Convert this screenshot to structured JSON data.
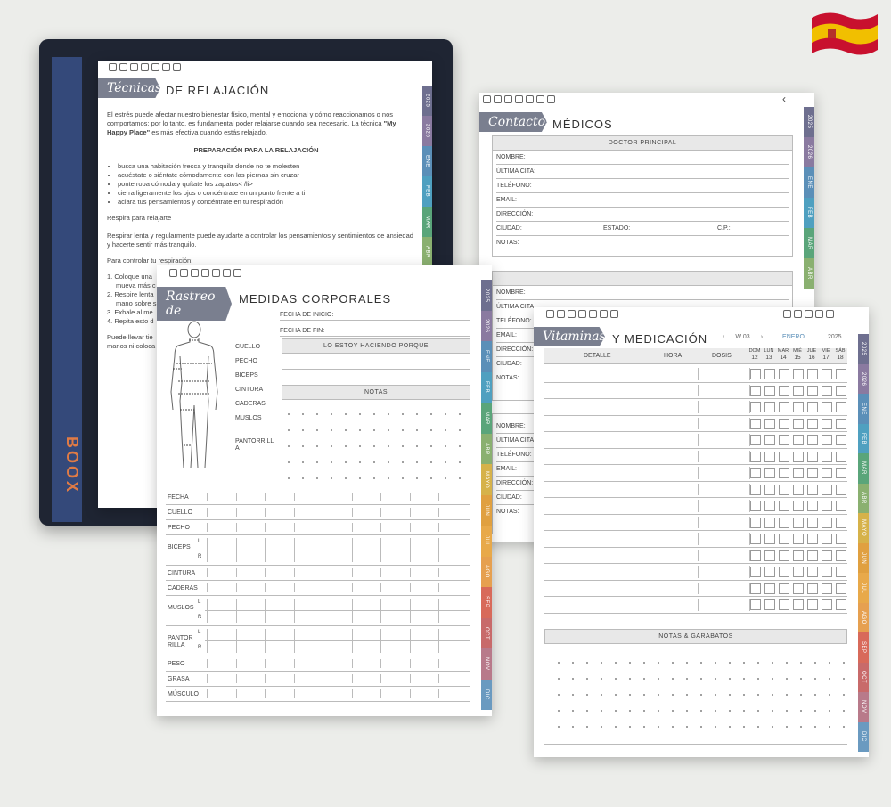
{
  "device": {
    "brand": "BOOX"
  },
  "relax": {
    "script_title": "Técnicas",
    "title": "DE RELAJACIÓN",
    "intro": "El estrés puede afectar nuestro bienestar físico, mental y emocional y cómo reaccionamos o nos comportamos; por lo tanto, es fundamental poder relajarse cuando sea necesario. La técnica",
    "intro_bold": "\"My Happy Place\"",
    "intro_end": " es más efectiva cuando estás relajado.",
    "prep_heading": "PREPARACIÓN PARA LA RELAJACIÓN",
    "bullets": [
      "busca una habitación fresca y tranquila donde no te molesten",
      "acuéstate o siéntate cómodamente con las piernas sin cruzar",
      "ponte ropa cómoda y quítate los zapatos< /li>",
      "cierra ligeramente los ojos o concéntrate en un punto frente a ti",
      "aclara tus pensamientos y concéntrate en tu respiración"
    ],
    "breathe": "Respira para relajarte",
    "breathe_text": "Respirar lenta y regularmente puede ayudarte a controlar los pensamientos y sentimientos de ansiedad y hacerte sentir más tranquilo.",
    "control": "Para controlar tu respiración:",
    "steps": [
      "1. Coloque una",
      "mueva más c",
      "2. Respire lenta",
      "mano sobre s",
      "3. Exhale al me",
      "4. Repita esto d"
    ],
    "outro": [
      "Puede llevar tie",
      "manos ni coloca"
    ],
    "tabs": [
      "2025",
      "2026",
      "ENE",
      "FEB",
      "MAR",
      "ABR"
    ]
  },
  "contacts": {
    "script_title": "Contactos",
    "title": "MÉDICOS",
    "box_title": "DOCTOR PRINCIPAL",
    "fields": [
      "NOMBRE:",
      "ÚLTIMA CITA:",
      "TELÉFONO:",
      "EMAIL:",
      "DIRECCIÓN:"
    ],
    "city": "CIUDAD:",
    "state": "ESTADO:",
    "zip": "C.P.:",
    "notes": "NOTAS:",
    "second_fields": [
      "NOMBRE:",
      "ÚLTIMA CITA",
      "TELÉFONO:",
      "EMAIL:",
      "DIRECCIÓN:",
      "CIUDAD:",
      "NOTAS:"
    ],
    "third_fields": [
      "NOMBRE:",
      "ÚLTIMA CITA",
      "TELÉFONO:",
      "EMAIL:",
      "DIRECCIÓN:",
      "CIUDAD:",
      "NOTAS:"
    ],
    "tabs": [
      "2025",
      "2026",
      "ENE",
      "FEB",
      "MAR",
      "ABR"
    ]
  },
  "measures": {
    "script_title": "Rastreo de",
    "title": "MEDIDAS CORPORALES",
    "start": "FECHA DE INICIO:",
    "end": "FECHA DE FIN:",
    "reason": "LO ESTOY HACIENDO PORQUE",
    "notes": "NOTAS",
    "body_labels": [
      "CUELLO",
      "PECHO",
      "BICEPS",
      "CINTURA",
      "CADERAS",
      "MUSLOS",
      "PANTORRILL A"
    ],
    "rows": [
      "FECHA",
      "CUELLO",
      "PECHO",
      "BICEPS",
      "CINTURA",
      "CADERAS",
      "MUSLOS",
      "PANTOR RILLA",
      "PESO",
      "GRASA",
      "MÚSCULO"
    ],
    "lr": [
      "L",
      "R"
    ],
    "tabs": [
      "2025",
      "2026",
      "ENE",
      "FEB",
      "MAR",
      "ABR",
      "MAYO",
      "JUN",
      "JUL",
      "AGO",
      "SEP",
      "OCT",
      "NOV",
      "DIC"
    ]
  },
  "vitamins": {
    "script_title": "Vitaminas",
    "title": "Y MEDICACIÓN",
    "week": "W 03",
    "month": "ENERO",
    "year": "2025",
    "cols": [
      "DETALLE",
      "HORA",
      "DOSIS"
    ],
    "days": [
      "DOM",
      "LUN",
      "MAR",
      "MIÉ",
      "JUE",
      "VIE",
      "SÁB"
    ],
    "dates": [
      "12",
      "13",
      "14",
      "15",
      "16",
      "17",
      "18"
    ],
    "notes": "NOTAS & GARABATOS",
    "tabs": [
      "2025",
      "2026",
      "ENE",
      "FEB",
      "MAR",
      "ABR",
      "MAYO",
      "JUN",
      "JUL",
      "AGO",
      "SEP",
      "OCT",
      "NOV",
      "DIC"
    ]
  },
  "colors": {
    "tab2025": "#6e6f8f",
    "tab2026": "#8a7aa0",
    "ene": "#5b8fb8",
    "feb": "#4fa0c0",
    "mar": "#5aa57a",
    "abr": "#8ab070",
    "mayo": "#d6b24a",
    "jun": "#e0a040",
    "jul": "#e8a94a",
    "ago": "#e6a050",
    "sep": "#d86a5a",
    "oct": "#c86a6a",
    "nov": "#b87a8a",
    "dic": "#6a9ac0"
  }
}
